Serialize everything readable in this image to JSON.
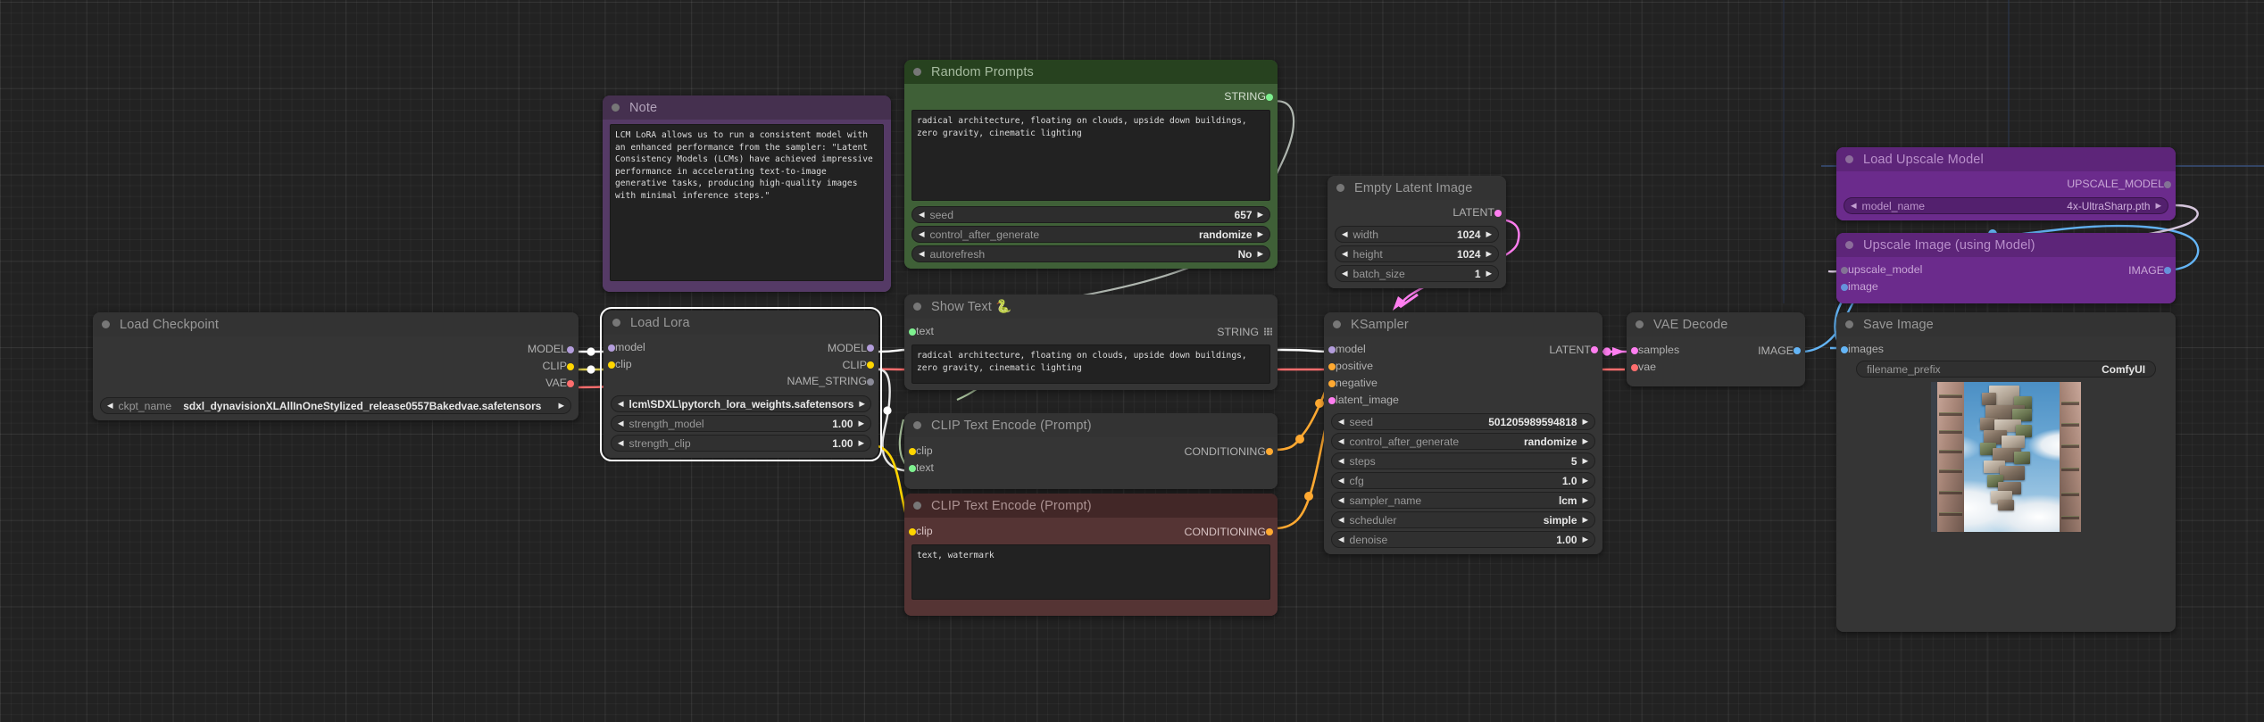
{
  "app": {
    "name": "ComfyUI",
    "canvas_bg": "#222222"
  },
  "colors": {
    "model": "#b39ddb",
    "clip": "#ffd500",
    "vae": "#ff6e6e",
    "conditioning": "#ffa931",
    "latent": "#ff7ef0",
    "image": "#64b5f6",
    "string": "#7ef08f",
    "bypass_purple": "#6b2b8c",
    "note_purple": "#553a66",
    "group_green": "#3f6037",
    "negative_red": "#553434"
  },
  "nodes": {
    "load_checkpoint": {
      "title": "Load Checkpoint",
      "outputs": [
        {
          "label": "MODEL",
          "type": "model"
        },
        {
          "label": "CLIP",
          "type": "clip"
        },
        {
          "label": "VAE",
          "type": "vae"
        }
      ],
      "widgets": [
        {
          "name": "ckpt_name",
          "value": "sdxl_dynavisionXLAllInOneStylized_release0557Bakedvae.safetensors"
        }
      ]
    },
    "load_lora": {
      "title": "Load Lora",
      "selected": true,
      "inputs": [
        {
          "label": "model",
          "type": "model"
        },
        {
          "label": "clip",
          "type": "clip"
        }
      ],
      "outputs": [
        {
          "label": "MODEL",
          "type": "model"
        },
        {
          "label": "CLIP",
          "type": "clip"
        },
        {
          "label": "NAME_STRING",
          "type": "gray"
        }
      ],
      "widgets": [
        {
          "name": "lora_name",
          "value": "lcm\\SDXL\\pytorch_lora_weights.safetensors",
          "centered": true
        },
        {
          "name": "strength_model",
          "value": "1.00"
        },
        {
          "name": "strength_clip",
          "value": "1.00"
        }
      ]
    },
    "note": {
      "title": "Note",
      "text": "LCM LoRA allows us to run a consistent model with an enhanced performance from the sampler: \"Latent Consistency Models (LCMs) have achieved impressive performance in accelerating text-to-image generative tasks, producing high-quality images with minimal inference steps.\""
    },
    "random_prompts": {
      "title": "Random Prompts",
      "outputs": [
        {
          "label": "STRING",
          "type": "string"
        }
      ],
      "text": "radical architecture, floating on clouds, upside down buildings, zero gravity, cinematic lighting",
      "widgets": [
        {
          "name": "seed",
          "value": "657"
        },
        {
          "name": "control_after_generate",
          "value": "randomize"
        },
        {
          "name": "autorefresh",
          "value": "No"
        }
      ]
    },
    "show_text": {
      "title": "Show Text 🐍",
      "inputs": [
        {
          "label": "text",
          "type": "string"
        }
      ],
      "outputs": [
        {
          "label": "STRING",
          "type": "grid"
        }
      ],
      "text": "radical architecture, floating on clouds, upside down buildings, zero gravity, cinematic lighting"
    },
    "clip_positive": {
      "title": "CLIP Text Encode (Prompt)",
      "inputs": [
        {
          "label": "clip",
          "type": "clip"
        },
        {
          "label": "text",
          "type": "string"
        }
      ],
      "outputs": [
        {
          "label": "CONDITIONING",
          "type": "conditioning"
        }
      ]
    },
    "clip_negative": {
      "title": "CLIP Text Encode (Prompt)",
      "inputs": [
        {
          "label": "clip",
          "type": "clip"
        }
      ],
      "outputs": [
        {
          "label": "CONDITIONING",
          "type": "conditioning"
        }
      ],
      "text": "text, watermark"
    },
    "empty_latent": {
      "title": "Empty Latent Image",
      "outputs": [
        {
          "label": "LATENT",
          "type": "latent"
        }
      ],
      "widgets": [
        {
          "name": "width",
          "value": "1024"
        },
        {
          "name": "height",
          "value": "1024"
        },
        {
          "name": "batch_size",
          "value": "1"
        }
      ]
    },
    "ksampler": {
      "title": "KSampler",
      "inputs": [
        {
          "label": "model",
          "type": "model"
        },
        {
          "label": "positive",
          "type": "conditioning"
        },
        {
          "label": "negative",
          "type": "conditioning"
        },
        {
          "label": "latent_image",
          "type": "latent"
        }
      ],
      "outputs": [
        {
          "label": "LATENT",
          "type": "latent"
        }
      ],
      "widgets": [
        {
          "name": "seed",
          "value": "501205989594818"
        },
        {
          "name": "control_after_generate",
          "value": "randomize"
        },
        {
          "name": "steps",
          "value": "5"
        },
        {
          "name": "cfg",
          "value": "1.0"
        },
        {
          "name": "sampler_name",
          "value": "lcm"
        },
        {
          "name": "scheduler",
          "value": "simple"
        },
        {
          "name": "denoise",
          "value": "1.00"
        }
      ]
    },
    "vae_decode": {
      "title": "VAE Decode",
      "inputs": [
        {
          "label": "samples",
          "type": "latent"
        },
        {
          "label": "vae",
          "type": "vae"
        }
      ],
      "outputs": [
        {
          "label": "IMAGE",
          "type": "image"
        }
      ]
    },
    "load_upscale_model": {
      "title": "Load Upscale Model",
      "bypassed": true,
      "outputs": [
        {
          "label": "UPSCALE_MODEL",
          "type": "gray"
        }
      ],
      "widgets": [
        {
          "name": "model_name",
          "value": "4x-UltraSharp.pth"
        }
      ]
    },
    "upscale_image": {
      "title": "Upscale Image (using Model)",
      "bypassed": true,
      "inputs": [
        {
          "label": "upscale_model",
          "type": "gray"
        },
        {
          "label": "image",
          "type": "image"
        }
      ],
      "outputs": [
        {
          "label": "IMAGE",
          "type": "image"
        }
      ]
    },
    "save_image": {
      "title": "Save Image",
      "inputs": [
        {
          "label": "images",
          "type": "image"
        }
      ],
      "widgets": [
        {
          "name": "filename_prefix",
          "value": "ComfyUI"
        }
      ],
      "preview_alt": "floating upside-down building among clouds"
    }
  }
}
